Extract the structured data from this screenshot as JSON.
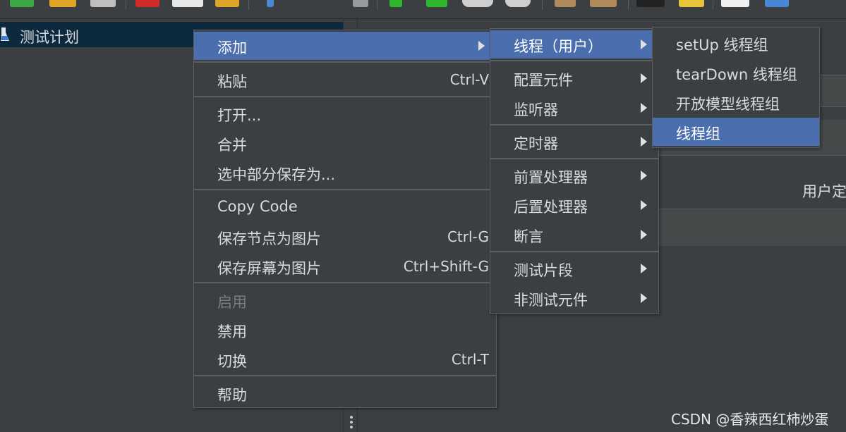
{
  "tree": {
    "root_label": "测试计划"
  },
  "right_panel": {
    "partial_label": "用户定"
  },
  "watermark": "CSDN @香辣西红柿炒蛋",
  "context_menu": {
    "items": [
      {
        "label": "添加",
        "submenu": true,
        "active": true
      },
      {
        "label": "粘贴",
        "shortcut": "Ctrl-V"
      },
      {
        "label": "打开..."
      },
      {
        "label": "合并"
      },
      {
        "label": "选中部分保存为..."
      },
      {
        "label": "Copy Code"
      },
      {
        "label": "保存节点为图片",
        "shortcut": "Ctrl-G"
      },
      {
        "label": "保存屏幕为图片",
        "shortcut": "Ctrl+Shift-G"
      },
      {
        "label": "启用",
        "disabled": true
      },
      {
        "label": "禁用"
      },
      {
        "label": "切换",
        "shortcut": "Ctrl-T"
      },
      {
        "label": "帮助"
      }
    ]
  },
  "add_submenu": {
    "items": [
      {
        "label": "线程（用户）",
        "submenu": true,
        "active": true
      },
      {
        "label": "配置元件",
        "submenu": true
      },
      {
        "label": "监听器",
        "submenu": true
      },
      {
        "label": "定时器",
        "submenu": true
      },
      {
        "label": "前置处理器",
        "submenu": true
      },
      {
        "label": "后置处理器",
        "submenu": true
      },
      {
        "label": "断言",
        "submenu": true
      },
      {
        "label": "测试片段",
        "submenu": true
      },
      {
        "label": "非测试元件",
        "submenu": true
      }
    ]
  },
  "threads_submenu": {
    "items": [
      {
        "label": "setUp 线程组"
      },
      {
        "label": "tearDown 线程组"
      },
      {
        "label": "开放模型线程组"
      },
      {
        "label": "线程组",
        "active": true
      }
    ]
  },
  "icons": [
    "template-icon",
    "open-icon",
    "save-icon",
    "cut-icon",
    "copy-icon",
    "paste-icon",
    "expand-icon",
    "wand-icon",
    "start-icon",
    "start-no-pause-icon",
    "stop-icon",
    "shutdown-icon",
    "clear-icon",
    "clear-all-icon",
    "search-icon",
    "reset-search-icon",
    "function-helper-icon",
    "help-icon"
  ],
  "colors": {
    "menu_bg": "#3c3f41",
    "highlight": "#4b6eaf",
    "tree_selected": "#0d293e",
    "text": "#d7dbe0",
    "disabled": "#7a7d80"
  }
}
